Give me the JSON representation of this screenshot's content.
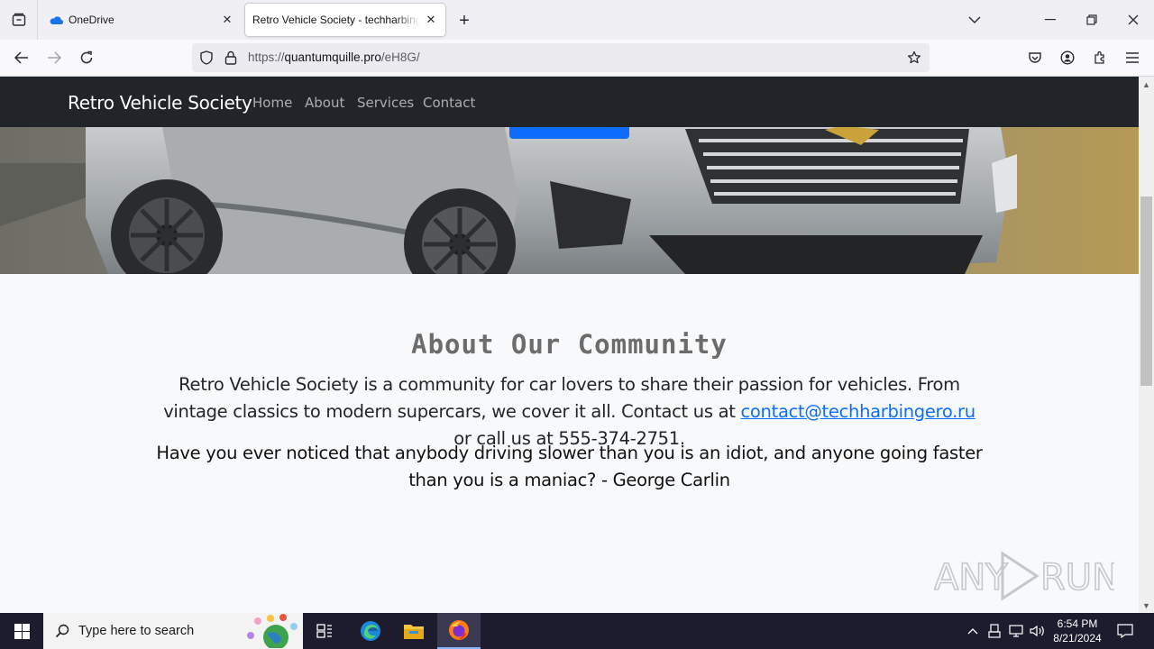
{
  "browser": {
    "tabs": [
      {
        "title": "OneDrive",
        "active": false
      },
      {
        "title": "Retro Vehicle Society - techharbingero",
        "active": true
      }
    ],
    "url_prefix": "https://",
    "url_host": "quantumquille.pro",
    "url_path": "/eH8G/"
  },
  "site": {
    "brand": "Retro Vehicle Society",
    "nav": [
      "Home",
      "About",
      "Services",
      "Contact"
    ]
  },
  "about": {
    "title": "About Our Community",
    "text_before_email": "Retro Vehicle Society is a community for car lovers to share their passion for vehicles. From vintage classics to modern supercars, we cover it all. Contact us at ",
    "email": "contact@techharbingero.ru",
    "text_after_email": " or call us at 555-374-2751.",
    "quote": "Have you ever noticed that anybody driving slower than you is an idiot, and anyone going faster than you is a maniac? - George Carlin"
  },
  "taskbar": {
    "search_placeholder": "Type here to search",
    "time": "6:54 PM",
    "date": "8/21/2024"
  },
  "watermark": "ANY RUN",
  "colors": {
    "site_nav_bg": "#212529",
    "link": "#0d6efd",
    "taskbar_bg": "#1c1c2e"
  }
}
